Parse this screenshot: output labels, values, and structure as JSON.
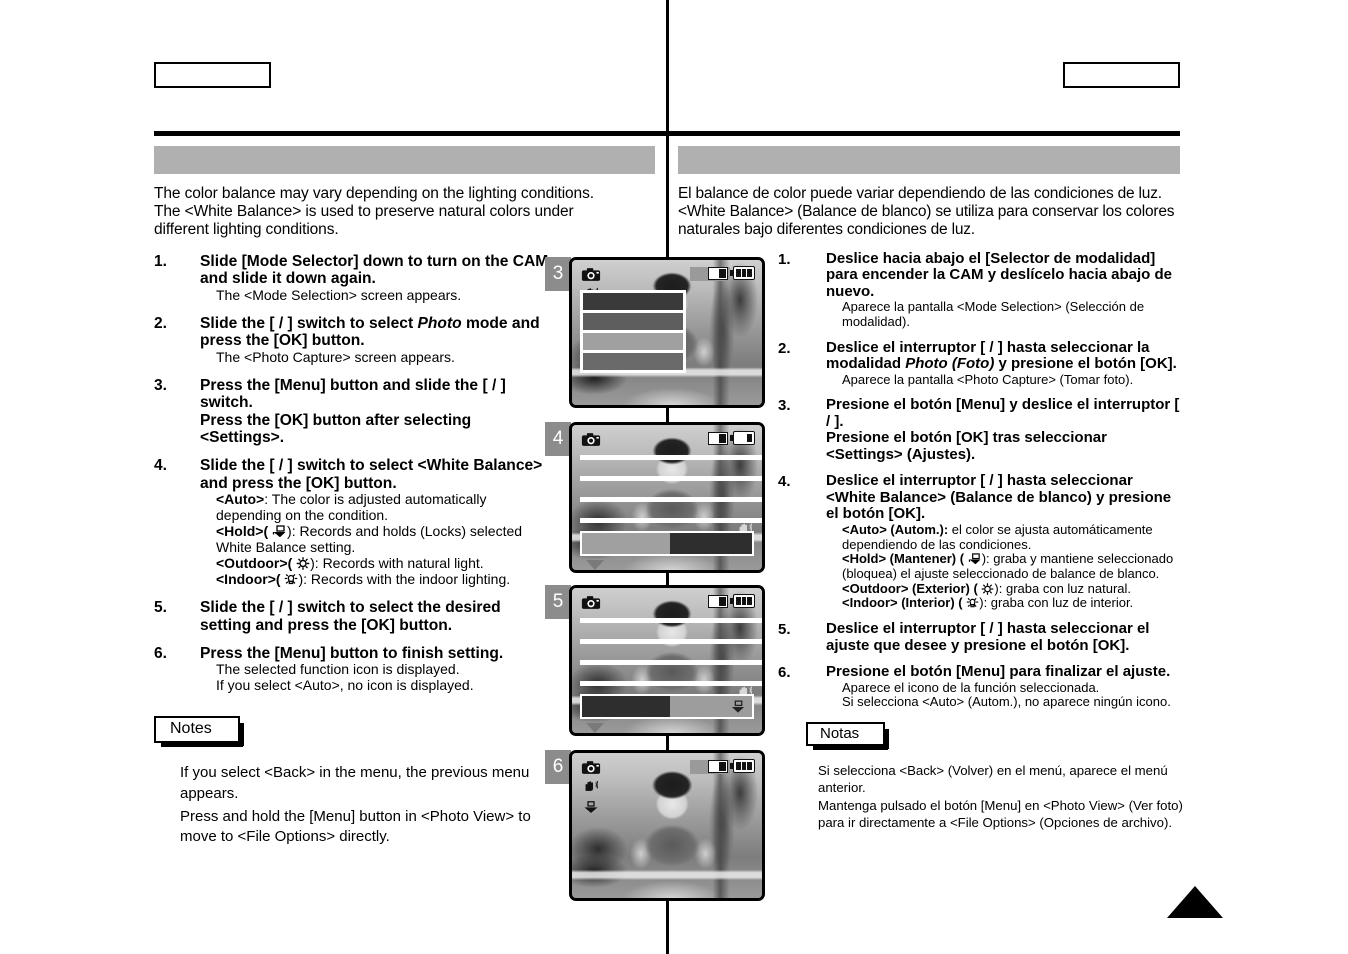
{
  "header": {
    "left_box_label": "",
    "right_box_label": ""
  },
  "section_title": {
    "left": "",
    "right": ""
  },
  "english": {
    "intro": "The color balance may vary depending on the lighting conditions. The <White Balance> is used to preserve natural colors under different lighting conditions.",
    "steps": [
      {
        "num": "1.",
        "title": "Slide [Mode Selector] down to turn on the CAM and slide it down again.",
        "subs": [
          "The <Mode Selection> screen appears."
        ]
      },
      {
        "num": "2.",
        "title_pre": "Slide the [    /    ] switch to select ",
        "title_italic": "Photo",
        "title_post": " mode and press the [OK] button.",
        "subs": [
          "The <Photo Capture> screen appears."
        ]
      },
      {
        "num": "3.",
        "title_line1": "Press the [Menu] button and slide the [    /    ] switch.",
        "title_line2": "Press the [OK] button after selecting <Settings>.",
        "subs": []
      },
      {
        "num": "4.",
        "title": "Slide the [    /    ] switch to select <White Balance> and press the [OK] button.",
        "options": [
          {
            "label": "<Auto>",
            "icon": "",
            "text": ": The color is adjusted automatically depending on the condition."
          },
          {
            "label": "<Hold>",
            "icon": "hold-wb-icon",
            "text": "): Records and holds (Locks) selected White Balance setting."
          },
          {
            "label": "<Outdoor>",
            "icon": "sun-icon",
            "text": "): Records with natural light."
          },
          {
            "label": "<Indoor>",
            "icon": "bulb-icon",
            "text": "): Records with the indoor lighting."
          }
        ]
      },
      {
        "num": "5.",
        "title": "Slide the [    /    ] switch to select the desired setting and press the [OK] button.",
        "subs": []
      },
      {
        "num": "6.",
        "title": "Press the [Menu] button to finish setting.",
        "subs": [
          "The selected function icon is displayed.",
          "If you select <Auto>, no icon is displayed."
        ]
      }
    ],
    "notes_tag": "Notes",
    "notes": [
      "If you select <Back> in the menu, the previous menu appears.",
      "Press and hold the [Menu] button in <Photo View> to move to <File Options> directly."
    ]
  },
  "spanish": {
    "intro": "El balance de color puede variar dependiendo de las condiciones de luz. <White Balance> (Balance de blanco) se utiliza para conservar los colores naturales bajo diferentes condiciones de luz.",
    "steps": [
      {
        "num": "1.",
        "title": "Deslice hacia abajo el [Selector de modalidad] para encender la CAM y deslícelo hacia abajo de nuevo.",
        "subs": [
          "Aparece la pantalla <Mode Selection> (Selección de modalidad)."
        ]
      },
      {
        "num": "2.",
        "title_pre": "Deslice el interruptor [    /    ] hasta seleccionar la modalidad ",
        "title_italic": "Photo (Foto)",
        "title_post": " y presione el botón [OK].",
        "subs": [
          "Aparece la pantalla <Photo Capture> (Tomar foto)."
        ]
      },
      {
        "num": "3.",
        "title_line1": "Presione el botón [Menu] y deslice el interruptor [    /    ].",
        "title_line2": "Presione el botón [OK] tras seleccionar <Settings> (Ajustes).",
        "subs": []
      },
      {
        "num": "4.",
        "title": "Deslice el interruptor [    /    ] hasta seleccionar <White Balance> (Balance de blanco) y presione el botón [OK].",
        "options": [
          {
            "label": "<Auto> (Autom.):",
            "icon": "",
            "text": " el color se ajusta automáticamente dependiendo de las condiciones."
          },
          {
            "label": "<Hold> (Mantener) (",
            "icon": "hold-wb-icon",
            "text": "): graba y mantiene seleccionado (bloquea) el ajuste seleccionado de balance de blanco."
          },
          {
            "label": "<Outdoor> (Exterior) (",
            "icon": "sun-icon",
            "text": "): graba con luz natural."
          },
          {
            "label": "<Indoor> (Interior) (",
            "icon": "bulb-icon",
            "text": "): graba con luz de interior."
          }
        ]
      },
      {
        "num": "5.",
        "title": "Deslice el interruptor [    /    ] hasta seleccionar el ajuste que desee y presione el botón [OK].",
        "subs": []
      },
      {
        "num": "6.",
        "title": "Presione el botón [Menu] para finalizar el ajuste.",
        "subs": [
          "Aparece el icono de la función seleccionada.",
          "Si selecciona <Auto> (Autom.), no aparece ningún icono."
        ]
      }
    ],
    "notes_tag": "Notas",
    "notes": [
      "Si selecciona <Back> (Volver) en el menú, aparece el menú anterior.",
      "Mantenga pulsado el botón [Menu] en <Photo View> (Ver foto) para ir directamente a <File Options> (Opciones de archivo)."
    ]
  },
  "screens": [
    {
      "badge": "3",
      "type": "menu",
      "status_icons": [
        "photo-mode-icon",
        "hand-shake-icon",
        "memory-card-icon",
        "battery-icon"
      ],
      "title_redacted": true,
      "menu_rows_shades": [
        "#3a3a3a",
        "#5e5e5e",
        "#a0a0a0",
        "#6a6a6a"
      ]
    },
    {
      "badge": "4",
      "type": "list",
      "status_icons": [
        "photo-mode-icon",
        "memory-card-icon",
        "battery-icon"
      ],
      "title_redacted": true,
      "bottom_bar": {
        "left_shade": "#a0a0a0",
        "right_shade": "#2e2e2e"
      }
    },
    {
      "badge": "5",
      "type": "list",
      "status_icons": [
        "photo-mode-icon",
        "memory-card-icon",
        "battery-icon",
        "hold-wb-icon"
      ],
      "title_redacted": true,
      "bottom_bar": {
        "left_shade": "#2e2e2e",
        "right_shade": "#9d9d9d"
      }
    },
    {
      "badge": "6",
      "type": "plain",
      "status_icons": [
        "photo-mode-icon",
        "hand-shake-icon",
        "hold-wb-icon",
        "memory-card-icon",
        "battery-icon"
      ],
      "title_redacted": true
    }
  ],
  "colors": {
    "title_bar": "#b0b0b0",
    "badge": "#8c8c8c",
    "rule": "#000000"
  },
  "end_marker": "page-continues-triangle"
}
